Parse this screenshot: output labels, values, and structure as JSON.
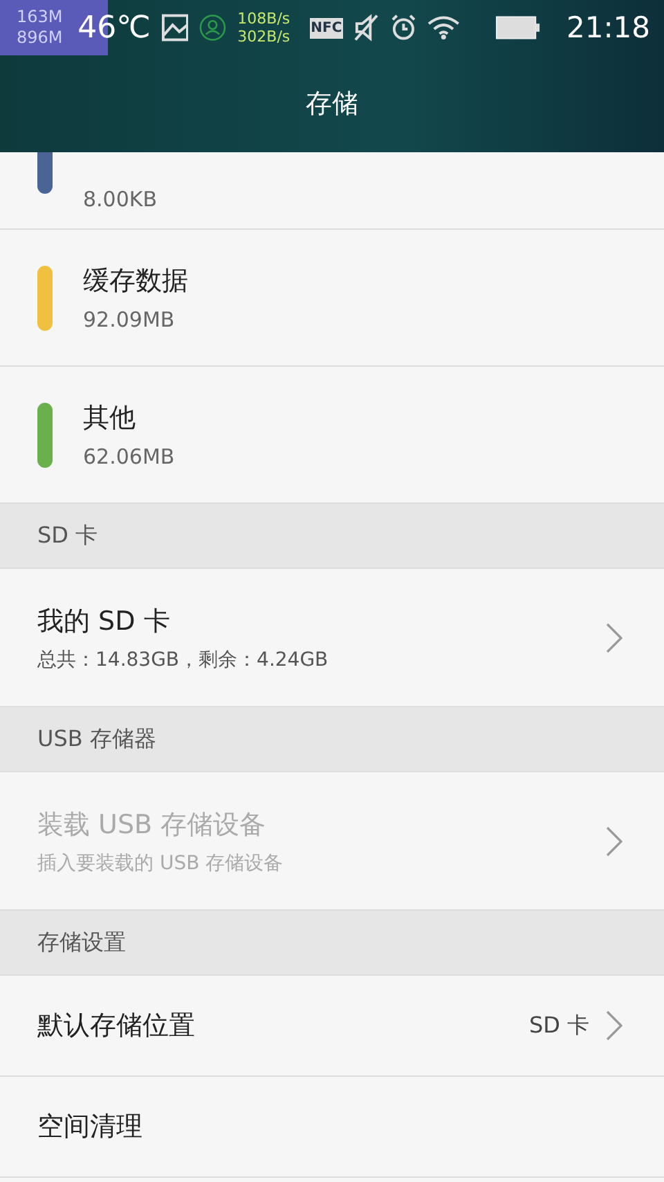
{
  "status_bar": {
    "memory_used": "163M",
    "memory_total": "896M",
    "temperature": "46℃",
    "upload_speed": "108B/s",
    "download_speed": "302B/s",
    "nfc": "NFC",
    "time": "21:18"
  },
  "header": {
    "title": "存储"
  },
  "usage": [
    {
      "size": "8.00KB",
      "color": "#4a6496",
      "cut": true
    },
    {
      "name": "缓存数据",
      "size": "92.09MB",
      "color": "#f0c040",
      "cut": false
    },
    {
      "name": "其他",
      "size": "62.06MB",
      "color": "#6ab04c",
      "cut": false
    }
  ],
  "sections": [
    {
      "title": "SD 卡",
      "items": [
        {
          "title": "我的 SD 卡",
          "subtitle": "总共：14.83GB，剩余：4.24GB",
          "disabled": false
        }
      ]
    },
    {
      "title": "USB 存储器",
      "items": [
        {
          "title": "装载 USB 存储设备",
          "subtitle": "插入要装载的 USB 存储设备",
          "disabled": true
        }
      ]
    },
    {
      "title": "存储设置",
      "items": [
        {
          "title": "默认存储位置",
          "value": "SD 卡",
          "disabled": false,
          "chevron": true
        },
        {
          "title": "空间清理",
          "disabled": false,
          "chevron": false
        }
      ]
    }
  ]
}
